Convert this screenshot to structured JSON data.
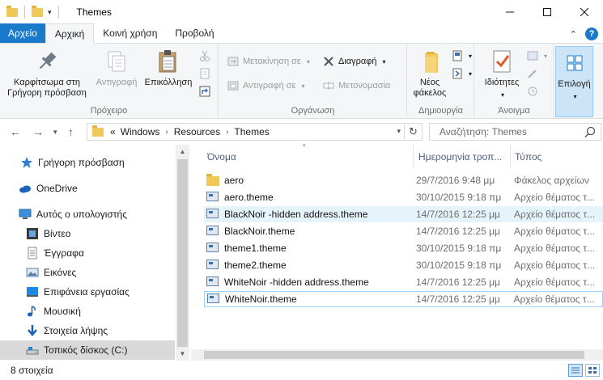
{
  "window": {
    "title": "Themes"
  },
  "tabs": [
    {
      "label": "Αρχείο"
    },
    {
      "label": "Αρχική"
    },
    {
      "label": "Κοινή χρήση"
    },
    {
      "label": "Προβολή"
    }
  ],
  "ribbon": {
    "clipboard": {
      "pin_label": "Καρφίτσωμα στη Γρήγορη πρόσβαση",
      "copy_label": "Αντιγραφή",
      "paste_label": "Επικόλληση",
      "group_label": "Πρόχειρο"
    },
    "organize": {
      "move_to_label": "Μετακίνηση σε",
      "copy_to_label": "Αντιγραφή σε",
      "delete_label": "Διαγραφή",
      "rename_label": "Μετονομασία",
      "group_label": "Οργάνωση"
    },
    "new": {
      "new_folder_label": "Νέος φάκελος",
      "group_label": "Δημιουργία"
    },
    "open": {
      "properties_label": "Ιδιότητες",
      "group_label": "Άνοιγμα"
    },
    "select": {
      "select_label": "Επιλογή"
    }
  },
  "address": {
    "overflow": "«",
    "crumbs": [
      "Windows",
      "Resources",
      "Themes"
    ],
    "search_placeholder": "Αναζήτηση: Themes"
  },
  "navpane": {
    "items": [
      {
        "label": "Γρήγορη πρόσβαση"
      },
      {
        "label": "OneDrive"
      },
      {
        "label": "Αυτός ο υπολογιστής"
      },
      {
        "label": "Βίντεο"
      },
      {
        "label": "Έγγραφα"
      },
      {
        "label": "Εικόνες"
      },
      {
        "label": "Επιφάνεια εργασίας"
      },
      {
        "label": "Μουσική"
      },
      {
        "label": "Στοιχεία λήψης"
      },
      {
        "label": "Τοπικός δίσκος (C:)"
      }
    ]
  },
  "filelist": {
    "columns": [
      "Όνομα",
      "Ημερομηνία τροπ...",
      "Τύπος"
    ],
    "rows": [
      {
        "name": "aero",
        "date": "29/7/2016 9:48 μμ",
        "type": "Φάκελος αρχείων",
        "kind": "folder"
      },
      {
        "name": "aero.theme",
        "date": "30/10/2015 9:18 πμ",
        "type": "Αρχείο θέματος τ...",
        "kind": "theme"
      },
      {
        "name": "BlackNoir -hidden address.theme",
        "date": "14/7/2016 12:25 μμ",
        "type": "Αρχείο θέματος τ...",
        "kind": "theme"
      },
      {
        "name": "BlackNoir.theme",
        "date": "14/7/2016 12:25 μμ",
        "type": "Αρχείο θέματος τ...",
        "kind": "theme"
      },
      {
        "name": "theme1.theme",
        "date": "30/10/2015 9:18 πμ",
        "type": "Αρχείο θέματος τ...",
        "kind": "theme"
      },
      {
        "name": "theme2.theme",
        "date": "30/10/2015 9:18 πμ",
        "type": "Αρχείο θέματος τ...",
        "kind": "theme"
      },
      {
        "name": "WhiteNoir -hidden address.theme",
        "date": "14/7/2016 12:25 μμ",
        "type": "Αρχείο θέματος τ...",
        "kind": "theme"
      },
      {
        "name": "WhiteNoir.theme",
        "date": "14/7/2016 12:25 μμ",
        "type": "Αρχείο θέματος τ...",
        "kind": "theme"
      }
    ]
  },
  "status": {
    "count": "8 στοιχεία"
  },
  "colors": {
    "accent": "#1979ca",
    "hover_row": "#e5f3fb",
    "selected_border": "#99d1ff"
  }
}
